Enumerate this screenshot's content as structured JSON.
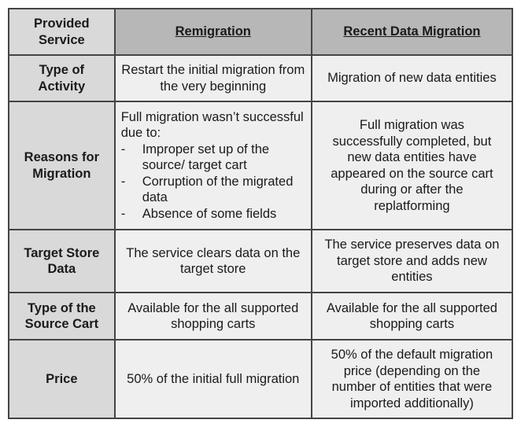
{
  "table": {
    "header": {
      "label": "Provided Service",
      "columns": [
        "Remigration",
        "Recent Data Migration"
      ]
    },
    "rows": [
      {
        "label": "Type of Activity",
        "remigration": "Restart the initial migration from the very beginning",
        "recent": "Migration of new data entities"
      },
      {
        "label": "Reasons for Migration",
        "remigration": {
          "intro": "Full migration wasn’t successful due to:",
          "items": [
            "Improper set up of the source/ target cart",
            "Corruption of the migrated data",
            "Absence of some fields"
          ]
        },
        "recent": "Full migration was successfully completed, but new data entities have appeared on the source cart during or after the replatforming"
      },
      {
        "label": "Target Store Data",
        "remigration": "The service clears data on the target store",
        "recent": "The service preserves data on target store and adds new entities"
      },
      {
        "label": "Type of the Source Cart",
        "remigration": "Available for the all supported shopping carts",
        "recent": "Available for the all supported shopping carts"
      },
      {
        "label": "Price",
        "remigration": "50% of the initial full migration",
        "recent": "50% of the default migration price (depending on the number of entities that were imported additionally)"
      }
    ]
  }
}
